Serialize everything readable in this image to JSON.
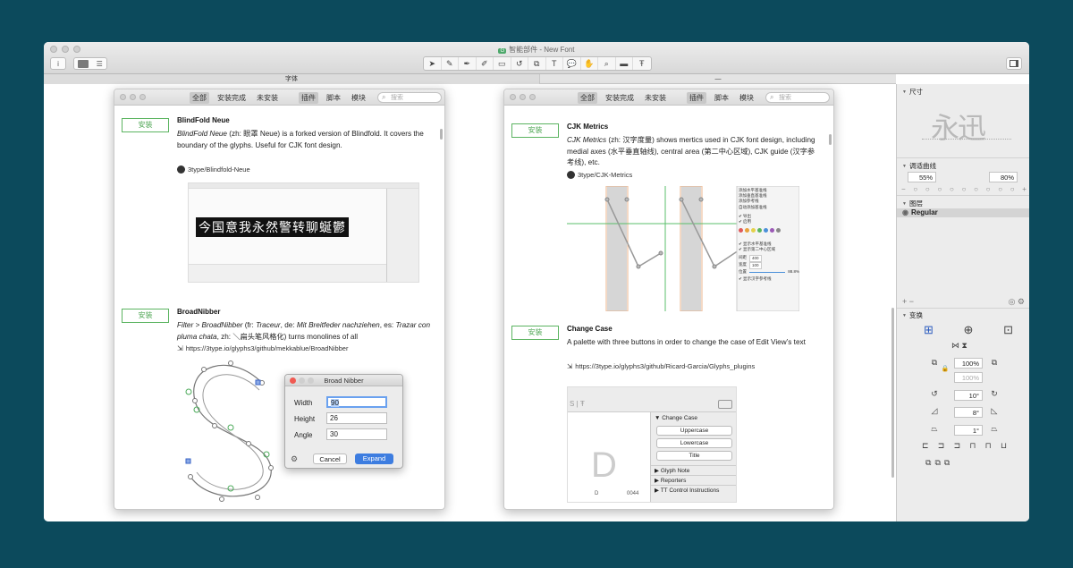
{
  "window": {
    "title": "智能部件 - New Font",
    "app_badge": "G",
    "info_label": "i",
    "tabs": [
      "字体",
      "—"
    ]
  },
  "filters": [
    "全部",
    "安装完成",
    "未安装",
    "插件",
    "脚本",
    "模块"
  ],
  "search_placeholder": "搜索",
  "install_label": "安装",
  "left_plugins": [
    {
      "name": "BlindFold Neue",
      "description_italic": "BlindFold Neue",
      "description": " (zh: 眼罩 Neue) is a forked version of Blindfold. It covers the boundary of the glyphs. Useful for CJK font design.",
      "link": "3type/Blindfold-Neue",
      "sample": "今国意我永然警转聊蜒鬱"
    },
    {
      "name": "BroadNibber",
      "description_italic": "Filter > BroadNibber",
      "description_mid1": " (fr: ",
      "italic_fr": "Traceur",
      "description_mid2": ", de: ",
      "italic_de": "Mit Breitfeder nachziehen",
      "description_mid3": ", es: ",
      "italic_es": "Trazar con pluma chata",
      "description_end": ", zh: ＼扁头笔风格化) turns monolines of all",
      "link": "https://3type.io/glyphs3/github/mekkablue/BroadNibber"
    }
  ],
  "broad_nibber": {
    "title": "Broad Nibber",
    "width_label": "Width",
    "width_value": "90",
    "height_label": "Height",
    "height_value": "26",
    "angle_label": "Angle",
    "angle_value": "30",
    "cancel": "Cancel",
    "expand": "Expand"
  },
  "right_plugins": [
    {
      "name": "CJK Metrics",
      "description_italic": "CJK Metrics",
      "description": " (zh: 汉字度量) shows mertics used in CJK font design, including medial axes (水平垂直轴线), central area (第二中心区域), CJK guide (汉字参考线), etc.",
      "link": "3type/CJK-Metrics",
      "menu": [
        "添加水平基准线",
        "添加垂直基准线",
        "添加参考线",
        "自动添加基准线",
        "✔ 导出",
        "✔ 启用",
        "✔ 显示水平基准线",
        "✔ 显示第二中心区域",
        "✔ 显示汉字参考线"
      ],
      "menu_values": [
        "400",
        "100",
        "88.8%"
      ],
      "menu_value_labels": [
        "间距",
        "宽度",
        "位置"
      ]
    },
    {
      "name": "Change Case",
      "description": "A palette with three buttons in order to change the case of Edit View’s text",
      "link": "https://3type.io/glyphs3/github/Ricard-Garcia/Glyphs_plugins",
      "palette_header": "Change Case",
      "buttons": [
        "Uppercase",
        "Lowercase",
        "Title"
      ],
      "sections": [
        "Glyph Note",
        "Reporters",
        "TT Control Instructions"
      ],
      "glyph": "D",
      "glyph_name": "D",
      "glyph_code": "0044"
    }
  ],
  "sidebar": {
    "size_label": "尺寸",
    "preview_text": "永迅",
    "curve_label": "调适曲线",
    "curve_values": [
      "55%",
      "80%"
    ],
    "layers_label": "图层",
    "layer_name": "Regular",
    "transform_label": "变换",
    "scale_values": [
      "100%",
      "100%"
    ],
    "rotate_value": "10°",
    "slant_value": "8°",
    "skew_value": "1°"
  }
}
